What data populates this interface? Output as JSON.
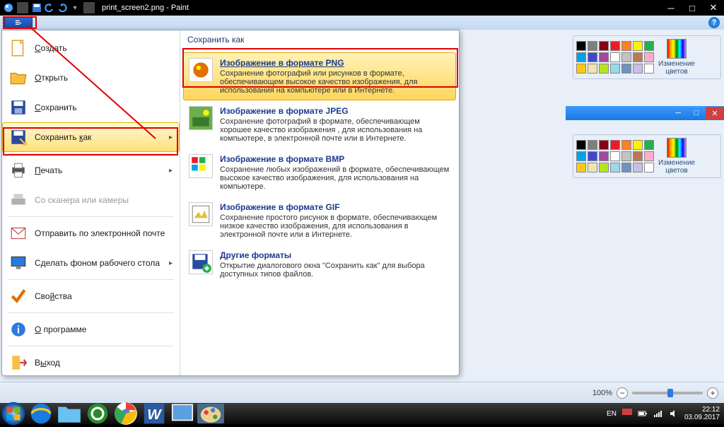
{
  "titlebar": {
    "title": "print_screen2.png - Paint"
  },
  "filemenu": {
    "left": {
      "create": "Создать",
      "open": "Открыть",
      "save": "Сохранить",
      "saveas": "Сохранить как",
      "print": "Печать",
      "scanner": "Со сканера или камеры",
      "email": "Отправить по электронной почте",
      "wallpaper": "Сделать фоном рабочего стола",
      "props": "Свойства",
      "about": "О программе",
      "exit": "Выход"
    },
    "right_header": "Сохранить как",
    "formats": {
      "png": {
        "title": "Изображение в формате PNG",
        "desc": "Сохранение фотографий или рисунков в формате, обеспечивающем высокое качество изображения, для использования на компьютере или в Интернете."
      },
      "jpeg": {
        "title": "Изображение в формате JPEG",
        "desc": "Сохранение фотографий в формате, обеспечивающем хорошее качество изображения , для использования на компьютере, в электронной почте или в Интернете."
      },
      "bmp": {
        "title": "Изображение в формате BMP",
        "desc": "Сохранение любых изображений в формате, обеспечивающем высокое качество изображения, для использования на компьютере."
      },
      "gif": {
        "title": "Изображение в формате GIF",
        "desc": "Сохранение простого рисунок в формате, обеспечивающем низкое качество изображения, для использования в электронной почте или в Интернете."
      },
      "other": {
        "title": "Другие форматы",
        "desc": "Открытие диалогового окна \"Сохранить как\" для выбора доступных типов файлов."
      }
    }
  },
  "palette_label": "Изменение цветов",
  "status": {
    "zoom": "100%"
  },
  "tray": {
    "lang": "EN",
    "time": "22:12",
    "date": "03.09.2017"
  }
}
